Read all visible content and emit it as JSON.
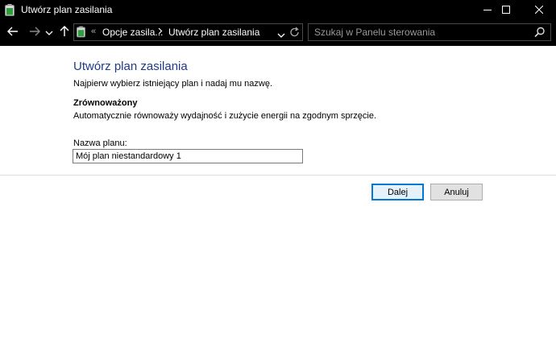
{
  "window": {
    "title": "Utwórz plan zasilania",
    "icon": "battery-icon",
    "controls": [
      "minimize-icon",
      "maximize-icon",
      "close-icon"
    ]
  },
  "navigation": {
    "back": "back-arrow-icon",
    "forward": "forward-arrow-icon",
    "recent": "chevron-down-icon",
    "up": "up-arrow-icon",
    "breadcrumb": [
      "Opcje zasila...",
      "Utwórz plan zasilania"
    ],
    "search_placeholder": "Szukaj w Panelu sterowania"
  },
  "main": {
    "heading": "Utwórz plan zasilania",
    "intro": "Najpierw wybierz istniejący plan i nadaj mu nazwę.",
    "selected_plan": {
      "name": "Zrównoważony",
      "description": "Automatycznie równoważy wydajność i zużycie energii na zgodnym sprzęcie."
    },
    "field_label": "Nazwa planu:",
    "field_value": "Mój plan niestandardowy 1",
    "next_button": "Dalej",
    "cancel_button": "Anuluj"
  },
  "colors": {
    "titlebar": "#000000",
    "heading": "#1e3a8a",
    "accent": "#0078d7",
    "battery": "#2e9e3e"
  }
}
